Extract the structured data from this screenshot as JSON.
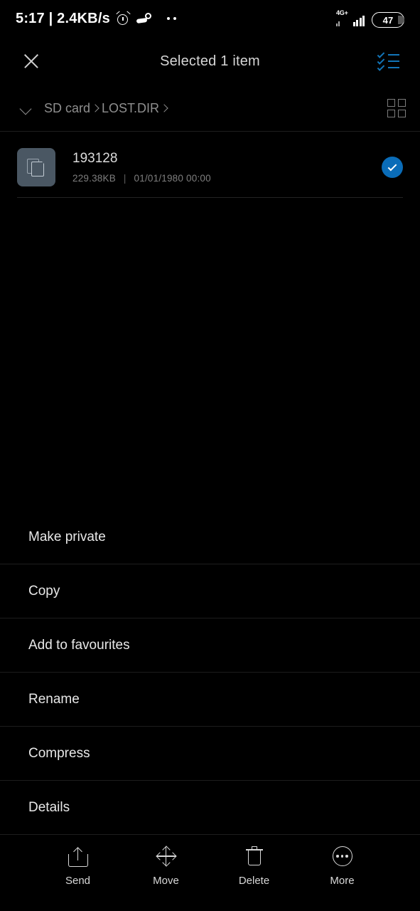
{
  "status_bar": {
    "clock": "5:17 | 2.4KB/s",
    "alarm_icon": "alarm-clock-icon",
    "steam_icon": "steam-icon",
    "overflow_dots": "more-notifications-dots",
    "network_type": "4G+",
    "battery_level": "47"
  },
  "app_bar": {
    "close_icon": "close-icon",
    "title": "Selected 1 item",
    "select_all_icon": "select-all-checklist-icon"
  },
  "breadcrumb": {
    "expand_icon": "chevron-down-icon",
    "segments": [
      "SD card",
      "LOST.DIR"
    ],
    "view_toggle_icon": "grid-view-icon"
  },
  "file_list": {
    "items": [
      {
        "name": "193128",
        "size": "229.38KB",
        "separator": "|",
        "date": "01/01/1980 00:00",
        "selected": true,
        "thumb_icon": "document-copy-icon",
        "check_icon": "check-circle-icon"
      }
    ]
  },
  "action_menu": {
    "items": [
      {
        "label": "Make private"
      },
      {
        "label": "Copy"
      },
      {
        "label": "Add to favourites"
      },
      {
        "label": "Rename"
      },
      {
        "label": "Compress"
      },
      {
        "label": "Details"
      }
    ]
  },
  "bottom_bar": {
    "tools": [
      {
        "label": "Send",
        "icon": "share-upload-icon"
      },
      {
        "label": "Move",
        "icon": "move-arrows-icon"
      },
      {
        "label": "Delete",
        "icon": "trash-icon"
      },
      {
        "label": "More",
        "icon": "more-circle-icon"
      }
    ]
  },
  "colors": {
    "background": "#000000",
    "accent_blue": "#0a6cb8",
    "checklist_blue": "#1275b8",
    "thumb_bg": "#4a5763",
    "primary_text": "#e8e8e8",
    "secondary_text": "#8f8f8f",
    "divider": "#1d1d1d"
  }
}
